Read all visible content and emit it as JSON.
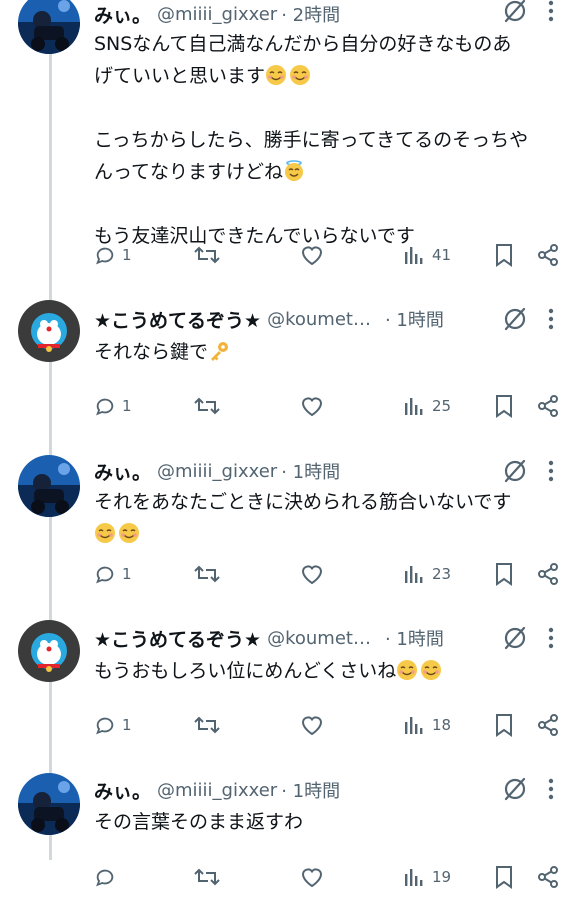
{
  "tweets": [
    {
      "name": "みぃ。",
      "handle": "@miiii_gixxer",
      "time": "· 2時間",
      "lines": [
        "SNSなんて自己満なんだから自分の好きなものあ",
        "げていいと思います",
        "",
        "こっちからしたら、勝手に寄ってきてるのそっちや",
        "んってなりますけどね",
        "",
        "もう友達沢山できたんでいらないです"
      ],
      "replies": "1",
      "views": "41"
    },
    {
      "name": "★こうめてるぞう★",
      "handle": "@koumet…",
      "time": "· 1時間",
      "lines": [
        "それなら鍵で"
      ],
      "replies": "1",
      "views": "25"
    },
    {
      "name": "みぃ。",
      "handle": "@miiii_gixxer",
      "time": "· 1時間",
      "lines": [
        "それをあなたごときに決められる筋合いないです",
        ""
      ],
      "replies": "1",
      "views": "23"
    },
    {
      "name": "★こうめてるぞう★",
      "handle": "@koumet…",
      "time": "· 1時間",
      "lines": [
        "もうおもしろい位にめんどくさいね"
      ],
      "replies": "1",
      "views": "18"
    },
    {
      "name": "みぃ。",
      "handle": "@miiii_gixxer",
      "time": "· 1時間",
      "lines": [
        "その言葉そのまま返すわ"
      ],
      "replies": "",
      "views": "19"
    }
  ],
  "icons": {
    "reply": "reply-icon",
    "retweet": "retweet-icon",
    "like": "like-icon",
    "views": "views-icon",
    "bookmark": "bookmark-icon",
    "share": "share-icon",
    "grok": "grok-icon",
    "more": "more-icon",
    "smile": "smiling-face-emoji",
    "halo": "halo-face-emoji",
    "key": "key-emoji"
  },
  "colors": {
    "text": "#0f1419",
    "secondary": "#536471",
    "thread_line": "#cfd9de",
    "emoji": "#f7c948"
  }
}
